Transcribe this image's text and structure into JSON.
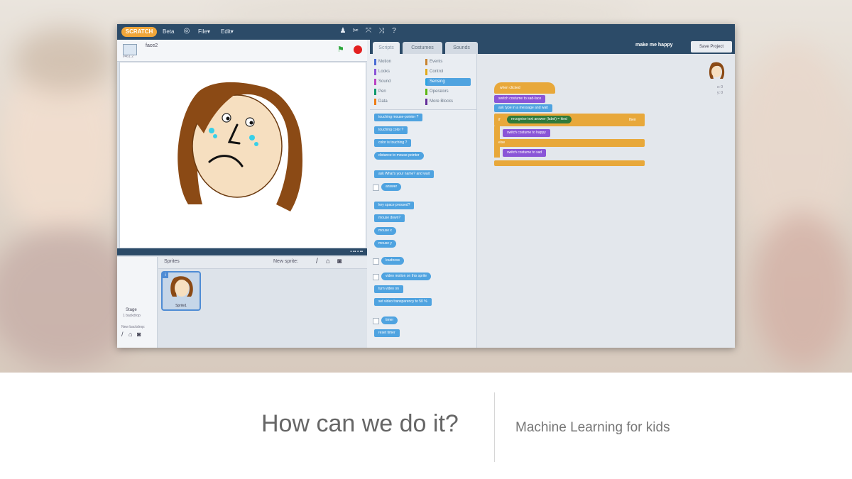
{
  "menubar": {
    "logo": "SCRATCH",
    "language_menu": "Beta",
    "file_menu": "File▾",
    "edit_menu": "Edit▾",
    "tools": [
      "person-icon",
      "scissors-icon",
      "grow-icon",
      "shrink-icon",
      "help-icon"
    ]
  },
  "stage": {
    "sprite_name": "face2",
    "version": "v461.2"
  },
  "sprites_pane": {
    "title": "Sprites",
    "new_sprite_label": "New sprite:",
    "stage_label": "Stage",
    "backdrop_count": "1 backdrop",
    "new_backdrop_label": "New backdrop:",
    "sprite_card_label": "Sprite1"
  },
  "tabs": {
    "scripts": "Scripts",
    "costumes": "Costumes",
    "sounds": "Sounds"
  },
  "project": {
    "title": "make me happy",
    "share_button": "Save Project"
  },
  "categories": [
    {
      "label": "Motion",
      "color": "#4a6cd4"
    },
    {
      "label": "Looks",
      "color": "#8a55d7"
    },
    {
      "label": "Sound",
      "color": "#bb42c3"
    },
    {
      "label": "Pen",
      "color": "#0e9a6c"
    },
    {
      "label": "Data",
      "color": "#ee7d16"
    },
    {
      "label": "Events",
      "color": "#c88330"
    },
    {
      "label": "Control",
      "color": "#e1a91a"
    },
    {
      "label": "Sensing",
      "color": "#2ca5e2"
    },
    {
      "label": "Operators",
      "color": "#5cb712"
    },
    {
      "label": "More Blocks",
      "color": "#632d99"
    }
  ],
  "palette_blocks": [
    "touching mouse-pointer ?",
    "touching color ?",
    "color is touching ?",
    "distance to mouse-pointer",
    "ask What's your name? and wait",
    "answer",
    "key space pressed?",
    "mouse down?",
    "mouse x",
    "mouse y",
    "loudness",
    "video motion on this sprite",
    "turn video on",
    "set video transparency to 50 %",
    "timer",
    "reset timer"
  ],
  "script": {
    "hat": "when clicked",
    "switch_costume_1": "switch costume to sad-face",
    "ask": "ask type in a message and wait",
    "if_label": "if",
    "recognise": "recognise text answer (label) = kind",
    "then_label": "then",
    "switch_costume_2": "switch costume to happy",
    "else_label": "else",
    "switch_costume_3": "switch costume to sad"
  },
  "corner_readout": {
    "x": "x: 0",
    "y": "y: 0"
  },
  "caption": {
    "left": "How can we do it?",
    "right": "Machine Learning for kids"
  }
}
